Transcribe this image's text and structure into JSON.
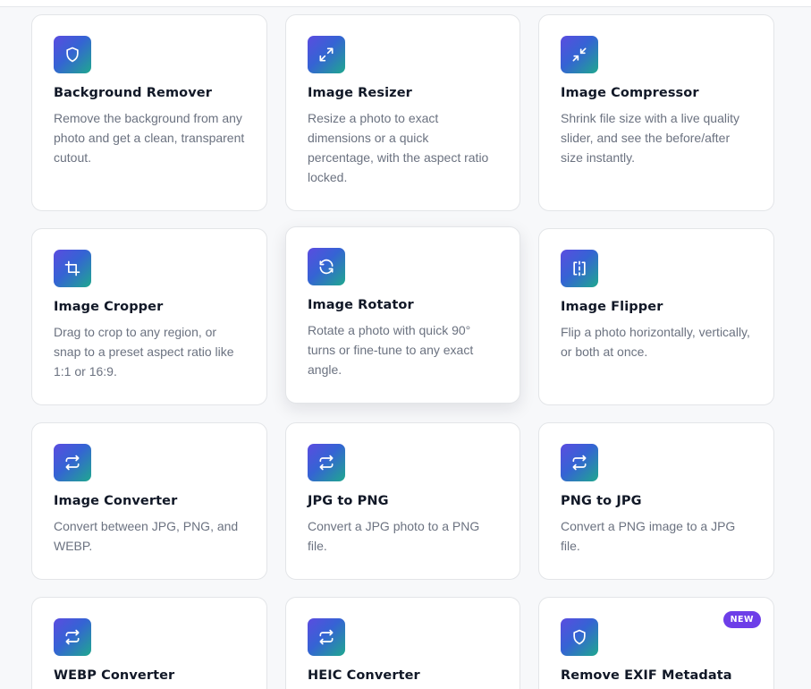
{
  "tools": [
    {
      "title": "Background Remover",
      "desc": "Remove the background from any photo and get a clean, transparent cutout.",
      "icon": "shield-icon"
    },
    {
      "title": "Image Resizer",
      "desc": "Resize a photo to exact dimensions or a quick percentage, with the aspect ratio locked.",
      "icon": "expand-icon"
    },
    {
      "title": "Image Compressor",
      "desc": "Shrink file size with a live quality slider, and see the before/after size instantly.",
      "icon": "compress-icon"
    },
    {
      "title": "Image Cropper",
      "desc": "Drag to crop to any region, or snap to a preset aspect ratio like 1:1 or 16:9.",
      "icon": "crop-icon"
    },
    {
      "title": "Image Rotator",
      "desc": "Rotate a photo with quick 90° turns or fine-tune to any exact angle.",
      "icon": "rotate-icon"
    },
    {
      "title": "Image Flipper",
      "desc": "Flip a photo horizontally, vertically, or both at once.",
      "icon": "flip-icon"
    },
    {
      "title": "Image Converter",
      "desc": "Convert between JPG, PNG, and WEBP.",
      "icon": "convert-icon"
    },
    {
      "title": "JPG to PNG",
      "desc": "Convert a JPG photo to a PNG file.",
      "icon": "convert-icon"
    },
    {
      "title": "PNG to JPG",
      "desc": "Convert a PNG image to a JPG file.",
      "icon": "convert-icon"
    },
    {
      "title": "WEBP Converter",
      "desc": "",
      "icon": "convert-icon"
    },
    {
      "title": "HEIC Converter",
      "desc": "",
      "icon": "convert-icon"
    },
    {
      "title": "Remove EXIF Metadata",
      "desc": "",
      "icon": "shield-icon",
      "badge": "NEW"
    }
  ],
  "colors": {
    "accent_start": "#5b4ce0",
    "accent_end": "#1fa88f",
    "badge": "#6d3ee8"
  }
}
